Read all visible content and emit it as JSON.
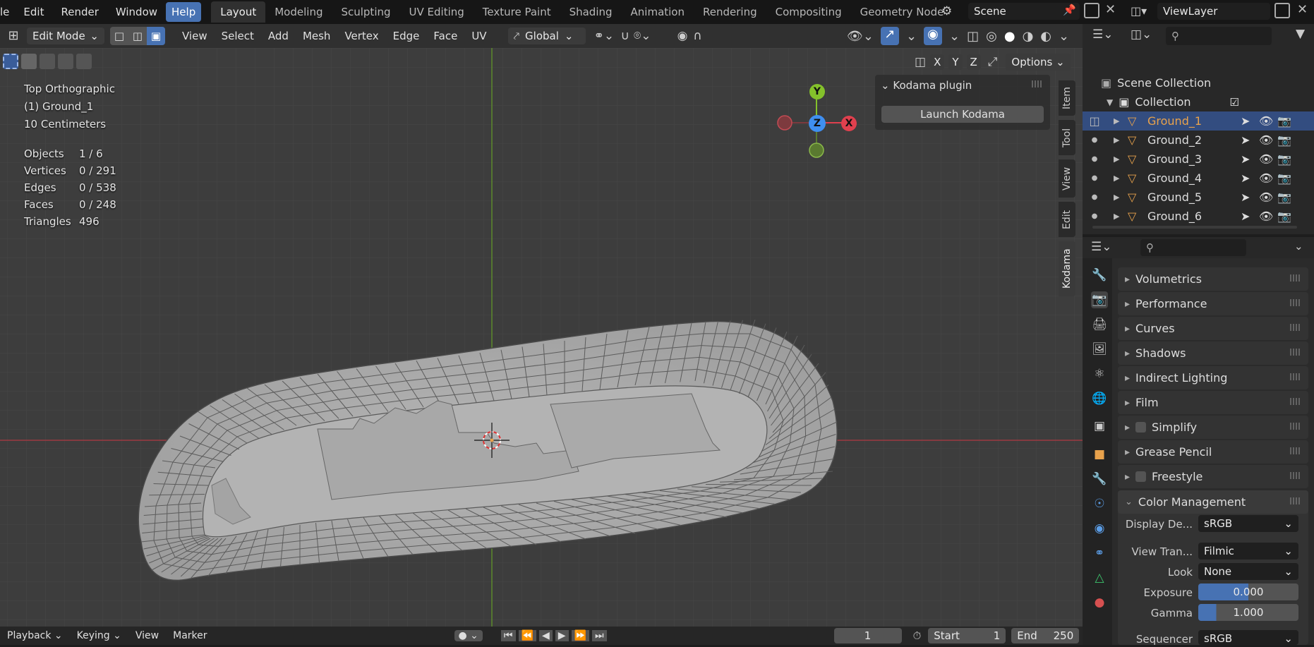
{
  "menu": {
    "file": "le",
    "edit": "Edit",
    "render": "Render",
    "window": "Window",
    "help": "Help"
  },
  "workspaces": [
    "Layout",
    "Modeling",
    "Sculpting",
    "UV Editing",
    "Texture Paint",
    "Shading",
    "Animation",
    "Rendering",
    "Compositing",
    "Geometry Node"
  ],
  "scene": {
    "name": "Scene",
    "view_layer": "ViewLayer"
  },
  "header": {
    "mode": "Edit Mode",
    "menus": [
      "View",
      "Select",
      "Add",
      "Mesh",
      "Vertex",
      "Edge",
      "Face",
      "UV"
    ],
    "orientation": "Global",
    "options": "Options",
    "axes": [
      "X",
      "Y",
      "Z"
    ]
  },
  "overlay": {
    "view_name": "Top Orthographic",
    "object": "(1) Ground_1",
    "scale": "10 Centimeters",
    "stats": [
      {
        "label": "Objects",
        "value": "1 / 6"
      },
      {
        "label": "Vertices",
        "value": "0 / 291"
      },
      {
        "label": "Edges",
        "value": "0 / 538"
      },
      {
        "label": "Faces",
        "value": "0 / 248"
      },
      {
        "label": "Triangles",
        "value": "496"
      }
    ]
  },
  "gizmo": {
    "y": "Y",
    "z": "Z",
    "x": "X"
  },
  "npanel": {
    "title": "Kodama plugin",
    "button": "Launch Kodama",
    "tabs": [
      "Item",
      "Tool",
      "View",
      "Edit",
      "Kodama"
    ]
  },
  "outliner": {
    "scene_collection": "Scene Collection",
    "collection": "Collection",
    "objects": [
      "Ground_1",
      "Ground_2",
      "Ground_3",
      "Ground_4",
      "Ground_5",
      "Ground_6"
    ]
  },
  "properties": {
    "sections": [
      "Volumetrics",
      "Performance",
      "Curves",
      "Shadows",
      "Indirect Lighting",
      "Film",
      "Simplify",
      "Grease Pencil",
      "Freestyle",
      "Color Management"
    ],
    "color_management": {
      "display_label": "Display De...",
      "display_value": "sRGB",
      "view_label": "View Tran...",
      "view_value": "Filmic",
      "look_label": "Look",
      "look_value": "None",
      "exposure_label": "Exposure",
      "exposure_value": "0.000",
      "gamma_label": "Gamma",
      "gamma_value": "1.000",
      "sequencer_label": "Sequencer",
      "sequencer_value": "sRGB"
    }
  },
  "timeline": {
    "playback": "Playback",
    "keying": "Keying",
    "view": "View",
    "marker": "Marker",
    "frame": "1",
    "start_label": "Start",
    "start": "1",
    "end_label": "End",
    "end": "250"
  },
  "colors": {
    "accent": "#4772b3",
    "selected": "#e8a24c",
    "x_axis": "#e0404e",
    "y_axis": "#84c12b",
    "z_axis": "#3f8ff0"
  }
}
